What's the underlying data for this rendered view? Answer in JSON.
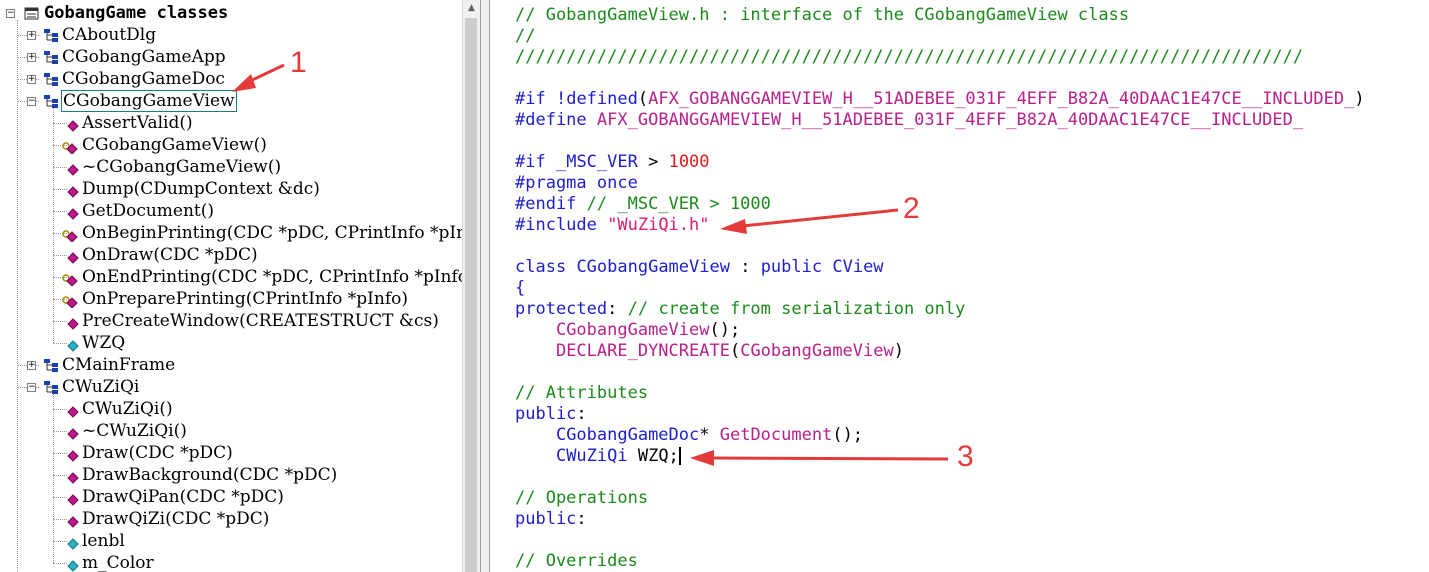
{
  "class_view": {
    "root_label": "GobangGame classes",
    "classes": [
      {
        "label": "CAboutDlg",
        "expanded": false
      },
      {
        "label": "CGobangGameApp",
        "expanded": false
      },
      {
        "label": "CGobangGameDoc",
        "expanded": false
      },
      {
        "label": "CGobangGameView",
        "expanded": true,
        "selected": true,
        "members": [
          {
            "label": "AssertValid()",
            "icon": "method-icon"
          },
          {
            "label": "CGobangGameView()",
            "icon": "protected-method-icon"
          },
          {
            "label": "~CGobangGameView()",
            "icon": "method-icon"
          },
          {
            "label": "Dump(CDumpContext &dc)",
            "icon": "method-icon"
          },
          {
            "label": "GetDocument()",
            "icon": "method-icon"
          },
          {
            "label": "OnBeginPrinting(CDC *pDC, CPrintInfo *pInfo)",
            "icon": "protected-method-icon"
          },
          {
            "label": "OnDraw(CDC *pDC)",
            "icon": "method-icon"
          },
          {
            "label": "OnEndPrinting(CDC *pDC, CPrintInfo *pInfo)",
            "icon": "protected-method-icon"
          },
          {
            "label": "OnPreparePrinting(CPrintInfo *pInfo)",
            "icon": "protected-method-icon"
          },
          {
            "label": "PreCreateWindow(CREATESTRUCT &cs)",
            "icon": "method-icon"
          },
          {
            "label": "WZQ",
            "icon": "member-variable-icon"
          }
        ]
      },
      {
        "label": "CMainFrame",
        "expanded": false
      },
      {
        "label": "CWuZiQi",
        "expanded": true,
        "members": [
          {
            "label": "CWuZiQi()",
            "icon": "method-icon"
          },
          {
            "label": "~CWuZiQi()",
            "icon": "method-icon"
          },
          {
            "label": "Draw(CDC *pDC)",
            "icon": "method-icon"
          },
          {
            "label": "DrawBackground(CDC *pDC)",
            "icon": "method-icon"
          },
          {
            "label": "DrawQiPan(CDC *pDC)",
            "icon": "method-icon"
          },
          {
            "label": "DrawQiZi(CDC *pDC)",
            "icon": "method-icon"
          },
          {
            "label": "lenbl",
            "icon": "member-variable-icon"
          },
          {
            "label": "m_Color",
            "icon": "member-variable-icon"
          }
        ]
      }
    ]
  },
  "editor": {
    "lines": [
      [
        {
          "t": "// GobangGameView.h : interface of the CGobangGameView class",
          "c": "cm"
        }
      ],
      [
        {
          "t": "//",
          "c": "cm"
        }
      ],
      [
        {
          "t": "/////////////////////////////////////////////////////////////////////////////",
          "c": "cm"
        }
      ],
      [],
      [
        {
          "t": "#if",
          "c": "kw"
        },
        {
          "t": " "
        },
        {
          "t": "!defined",
          "c": "kw"
        },
        {
          "t": "("
        },
        {
          "t": "AFX_GOBANGGAMEVIEW_H__51ADEBEE_031F_4EFF_B82A_40DAAC1E47CE__INCLUDED_",
          "c": "mac"
        },
        {
          "t": ")"
        }
      ],
      [
        {
          "t": "#define",
          "c": "kw"
        },
        {
          "t": " "
        },
        {
          "t": "AFX_GOBANGGAMEVIEW_H__51ADEBEE_031F_4EFF_B82A_40DAAC1E47CE__INCLUDED_",
          "c": "mac"
        }
      ],
      [],
      [
        {
          "t": "#if",
          "c": "kw"
        },
        {
          "t": " "
        },
        {
          "t": "_MSC_VER",
          "c": "kw"
        },
        {
          "t": " > "
        },
        {
          "t": "1000",
          "c": "num"
        }
      ],
      [
        {
          "t": "#pragma once",
          "c": "kw"
        }
      ],
      [
        {
          "t": "#endif",
          "c": "kw"
        },
        {
          "t": " // _MSC_VER > 1000",
          "c": "cm"
        }
      ],
      [
        {
          "t": "#include",
          "c": "kw"
        },
        {
          "t": " "
        },
        {
          "t": "\"WuZiQi.h\"",
          "c": "str"
        }
      ],
      [],
      [
        {
          "t": "class",
          "c": "kw"
        },
        {
          "t": " "
        },
        {
          "t": "CGobangGameView",
          "c": "ty"
        },
        {
          "t": " : "
        },
        {
          "t": "public",
          "c": "kw"
        },
        {
          "t": " "
        },
        {
          "t": "CView",
          "c": "ty"
        }
      ],
      [
        {
          "t": "{",
          "c": "kw"
        }
      ],
      [
        {
          "t": "protected",
          "c": "kw"
        },
        {
          "t": ": "
        },
        {
          "t": "// create from serialization only",
          "c": "cm"
        }
      ],
      [
        {
          "t": "    "
        },
        {
          "t": "CGobangGameView",
          "c": "mac"
        },
        {
          "t": "();"
        }
      ],
      [
        {
          "t": "    "
        },
        {
          "t": "DECLARE_DYNCREATE",
          "c": "mac"
        },
        {
          "t": "("
        },
        {
          "t": "CGobangGameView",
          "c": "mac"
        },
        {
          "t": ")"
        }
      ],
      [],
      [
        {
          "t": "// Attributes",
          "c": "cm"
        }
      ],
      [
        {
          "t": "public",
          "c": "kw"
        },
        {
          "t": ":"
        }
      ],
      [
        {
          "t": "    "
        },
        {
          "t": "CGobangGameDoc",
          "c": "ty"
        },
        {
          "t": "* "
        },
        {
          "t": "GetDocument",
          "c": "mac"
        },
        {
          "t": "();"
        }
      ],
      [
        {
          "t": "    "
        },
        {
          "t": "CWuZiQi",
          "c": "ty"
        },
        {
          "t": " WZQ;"
        },
        {
          "caret": true
        }
      ],
      [],
      [
        {
          "t": "// Operations",
          "c": "cm"
        }
      ],
      [
        {
          "t": "public",
          "c": "kw"
        },
        {
          "t": ":"
        }
      ],
      [],
      [
        {
          "t": "// Overrides",
          "c": "cm"
        }
      ]
    ]
  },
  "annotations": [
    {
      "label": "1",
      "points_to": "CGobangGameView class node"
    },
    {
      "label": "2",
      "points_to": "#include \"WuZiQi.h\""
    },
    {
      "label": "3",
      "points_to": "CWuZiQi WZQ;"
    }
  ],
  "colors": {
    "keyword": "#1e1ecc",
    "comment": "#1b8a1b",
    "macro": "#b8208c",
    "number": "#e01b1b",
    "string": "#e01b6e",
    "annotation": "#e53a3a"
  }
}
